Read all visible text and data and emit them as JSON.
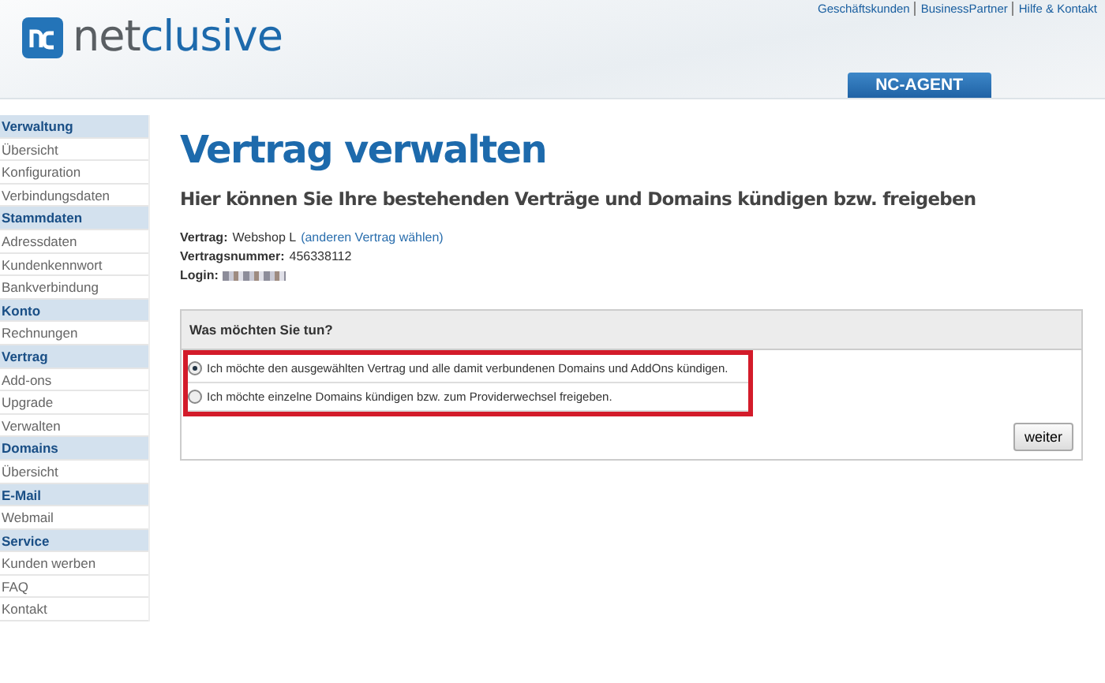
{
  "header": {
    "logo": "netclusive",
    "top_links": [
      "Geschäftskunden",
      "BusinessPartner",
      "Hilfe & Kontakt"
    ],
    "agent_tab": "NC-AGENT"
  },
  "sidebar": [
    {
      "kind": "section",
      "label": "Verwaltung"
    },
    {
      "kind": "item",
      "label": "Übersicht"
    },
    {
      "kind": "item",
      "label": "Konfiguration"
    },
    {
      "kind": "item",
      "label": "Verbindungsdaten"
    },
    {
      "kind": "section",
      "label": "Stammdaten"
    },
    {
      "kind": "item",
      "label": "Adressdaten"
    },
    {
      "kind": "item",
      "label": "Kundenkennwort"
    },
    {
      "kind": "item",
      "label": "Bankverbindung"
    },
    {
      "kind": "section",
      "label": "Konto"
    },
    {
      "kind": "item",
      "label": "Rechnungen"
    },
    {
      "kind": "section",
      "label": "Vertrag"
    },
    {
      "kind": "item",
      "label": "Add-ons"
    },
    {
      "kind": "item",
      "label": "Upgrade"
    },
    {
      "kind": "item",
      "label": "Verwalten"
    },
    {
      "kind": "section",
      "label": "Domains"
    },
    {
      "kind": "item",
      "label": "Übersicht"
    },
    {
      "kind": "section",
      "label": "E-Mail"
    },
    {
      "kind": "item",
      "label": "Webmail"
    },
    {
      "kind": "section",
      "label": "Service"
    },
    {
      "kind": "item",
      "label": "Kunden werben"
    },
    {
      "kind": "item",
      "label": "FAQ"
    },
    {
      "kind": "item",
      "label": "Kontakt"
    }
  ],
  "main": {
    "title": "Vertrag verwalten",
    "subtitle": "Hier können Sie Ihre bestehenden Verträge und Domains kündigen bzw. freigeben",
    "info": [
      {
        "label": "Vertrag:",
        "value": "Webshop L",
        "link": "(anderen Vertrag wählen)"
      },
      {
        "label": "Vertragsnummer:",
        "value": "456338112"
      },
      {
        "label": "Login:",
        "blurred": true
      }
    ],
    "panel": {
      "heading": "Was möchten Sie tun?",
      "options": [
        {
          "label": "Ich möchte den ausgewählten Vertrag und alle damit verbundenen Domains und AddOns kündigen.",
          "selected": true
        },
        {
          "label": "Ich möchte einzelne Domains kündigen bzw. zum Providerwechsel freigeben.",
          "selected": false
        }
      ],
      "button": "weiter"
    }
  }
}
